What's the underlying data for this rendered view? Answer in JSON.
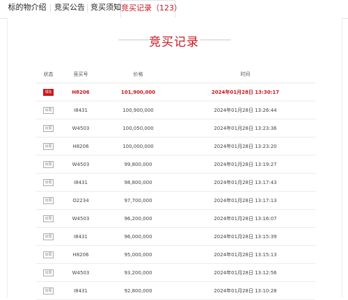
{
  "tabs": [
    {
      "label": "标的物介绍"
    },
    {
      "label": "竞买公告"
    },
    {
      "label": "竞买须知"
    },
    {
      "label": "竞买记录（123）"
    }
  ],
  "section_title": "竞买记录",
  "table": {
    "headers": [
      "状态",
      "竞买号",
      "价格",
      "时间"
    ],
    "rows": [
      {
        "status": "领先",
        "bidder": "H8206",
        "price": "101,900,000",
        "time": "2024年01月28日 13:30:17"
      },
      {
        "status": "出局",
        "bidder": "I8431",
        "price": "100,900,000",
        "time": "2024年01月28日 13:26:44"
      },
      {
        "status": "出局",
        "bidder": "W4503",
        "price": "100,050,000",
        "time": "2024年01月28日 13:23:36"
      },
      {
        "status": "出局",
        "bidder": "H8206",
        "price": "100,000,000",
        "time": "2024年01月28日 13:23:20"
      },
      {
        "status": "出局",
        "bidder": "W4503",
        "price": "99,800,000",
        "time": "2024年01月28日 13:19:27"
      },
      {
        "status": "出局",
        "bidder": "I8431",
        "price": "98,800,000",
        "time": "2024年01月28日 13:17:43"
      },
      {
        "status": "出局",
        "bidder": "O2234",
        "price": "97,700,000",
        "time": "2024年01月28日 13:17:13"
      },
      {
        "status": "出局",
        "bidder": "W4503",
        "price": "96,200,000",
        "time": "2024年01月28日 13:16:07"
      },
      {
        "status": "出局",
        "bidder": "I8431",
        "price": "96,000,000",
        "time": "2024年01月28日 13:15:39"
      },
      {
        "status": "出局",
        "bidder": "H8206",
        "price": "95,000,000",
        "time": "2024年01月28日 13:15:13"
      },
      {
        "status": "出局",
        "bidder": "W4503",
        "price": "93,200,000",
        "time": "2024年01月28日 13:12:56"
      },
      {
        "status": "出局",
        "bidder": "I8431",
        "price": "92,800,000",
        "time": "2024年01月28日 13:10:28"
      }
    ]
  },
  "colors": {
    "accent": "#c8161d",
    "muted_badge": "#888888"
  }
}
